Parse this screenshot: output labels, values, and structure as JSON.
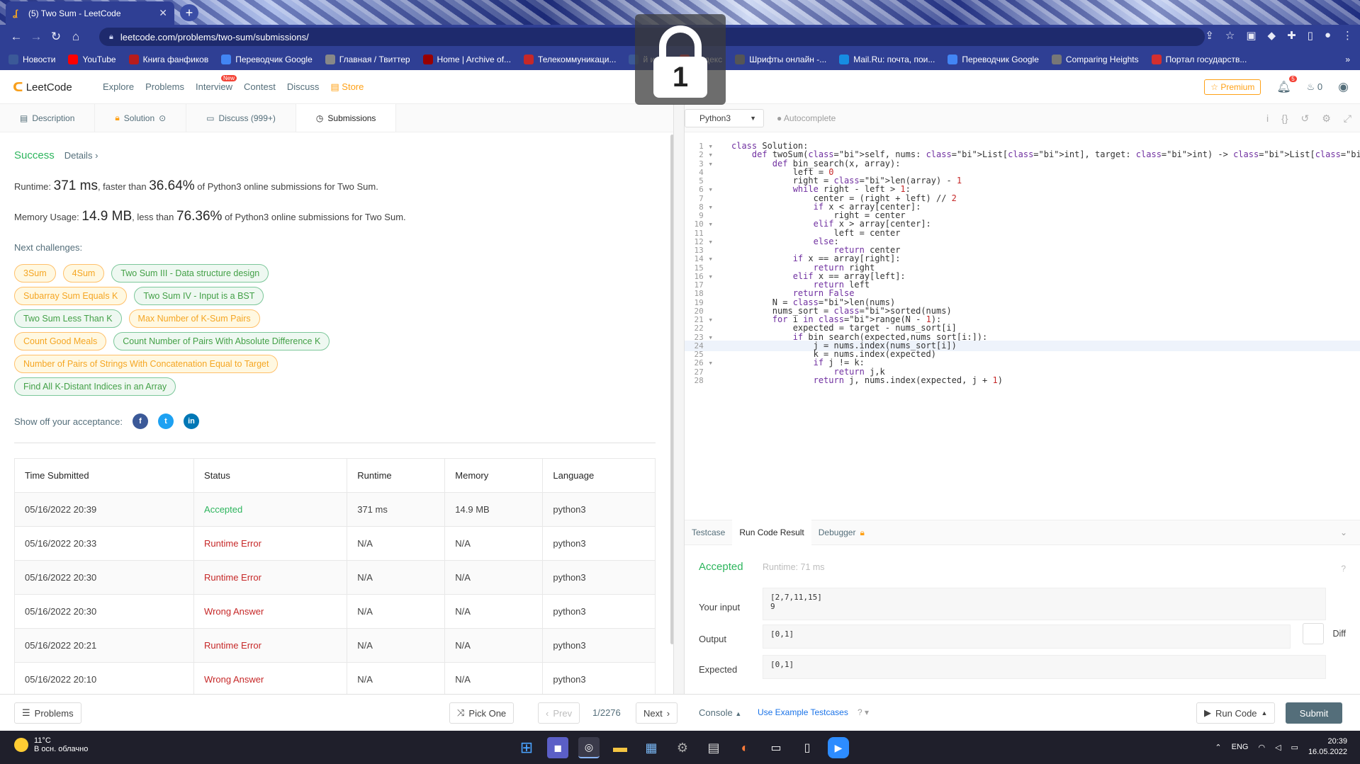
{
  "browser": {
    "tab_title": "(5) Two Sum - LeetCode",
    "url": "leetcode.com/problems/two-sum/submissions/",
    "bookmarks": [
      {
        "label": "Новости",
        "color": "#3b5998",
        "icon": "vk-icon"
      },
      {
        "label": "YouTube",
        "color": "#ff0000",
        "icon": "youtube-icon"
      },
      {
        "label": "Книга фанфиков",
        "color": "#b71c1c",
        "icon": "book-icon"
      },
      {
        "label": "Переводчик Google",
        "color": "#4285f4",
        "icon": "translate-icon"
      },
      {
        "label": "Главная / Твиттер",
        "color": "#888888",
        "icon": "globe-icon"
      },
      {
        "label": "Home | Archive of...",
        "color": "#990000",
        "icon": "ao3-icon"
      },
      {
        "label": "Телекоммуникаци...",
        "color": "#c62828",
        "icon": "globe-icon"
      },
      {
        "label": "й ин...",
        "color": "#3b5998",
        "icon": "globe-icon"
      },
      {
        "label": "Яндекс",
        "color": "#ff3333",
        "icon": "yandex-icon"
      },
      {
        "label": "Шрифты онлайн -...",
        "color": "#555555",
        "icon": "font-icon"
      },
      {
        "label": "Mail.Ru: почта, пои...",
        "color": "#168de2",
        "icon": "mail-icon"
      },
      {
        "label": "Переводчик Google",
        "color": "#4285f4",
        "icon": "translate-icon"
      },
      {
        "label": "Comparing Heights",
        "color": "#777777",
        "icon": "globe-icon"
      },
      {
        "label": "Портал государств...",
        "color": "#d32f2f",
        "icon": "gov-icon"
      }
    ],
    "more_bookmarks": "»"
  },
  "overlay": {
    "lock_number": "1"
  },
  "leetcode_nav": {
    "logo": "LeetCode",
    "links": [
      "Explore",
      "Problems",
      "Interview",
      "Contest",
      "Discuss"
    ],
    "new_badge": "New",
    "store": "Store",
    "premium": "Premium",
    "notifications": "5",
    "streak": "0"
  },
  "left_tabs": [
    {
      "label": "Description",
      "icon": "doc-icon"
    },
    {
      "label": "Solution",
      "icon": "lock-icon"
    },
    {
      "label": "Discuss (999+)",
      "icon": "chat-icon"
    },
    {
      "label": "Submissions",
      "icon": "clock-icon"
    }
  ],
  "submission": {
    "status": "Success",
    "details": "Details",
    "runtime_label": "Runtime: ",
    "runtime_value": "371 ms",
    "runtime_mid": ", faster than ",
    "runtime_pct": "36.64%",
    "runtime_tail": " of Python3 online submissions for Two Sum.",
    "memory_label": "Memory Usage: ",
    "memory_value": "14.9 MB",
    "memory_mid": ", less than ",
    "memory_pct": "76.36%",
    "memory_tail": " of Python3 online submissions for Two Sum.",
    "next_label": "Next challenges:",
    "show_off": "Show off your acceptance:"
  },
  "challenges": [
    [
      {
        "label": "3Sum",
        "level": "m"
      },
      {
        "label": "4Sum",
        "level": "m"
      },
      {
        "label": "Two Sum III - Data structure design",
        "level": "e"
      }
    ],
    [
      {
        "label": "Subarray Sum Equals K",
        "level": "m"
      },
      {
        "label": "Two Sum IV - Input is a BST",
        "level": "e"
      }
    ],
    [
      {
        "label": "Two Sum Less Than K",
        "level": "e"
      },
      {
        "label": "Max Number of K-Sum Pairs",
        "level": "m"
      }
    ],
    [
      {
        "label": "Count Good Meals",
        "level": "m"
      },
      {
        "label": "Count Number of Pairs With Absolute Difference K",
        "level": "e"
      }
    ],
    [
      {
        "label": "Number of Pairs of Strings With Concatenation Equal to Target",
        "level": "m"
      }
    ],
    [
      {
        "label": "Find All K-Distant Indices in an Array",
        "level": "e"
      }
    ]
  ],
  "table": {
    "headers": [
      "Time Submitted",
      "Status",
      "Runtime",
      "Memory",
      "Language"
    ],
    "rows": [
      [
        "05/16/2022 20:39",
        "Accepted",
        "371 ms",
        "14.9 MB",
        "python3"
      ],
      [
        "05/16/2022 20:33",
        "Runtime Error",
        "N/A",
        "N/A",
        "python3"
      ],
      [
        "05/16/2022 20:30",
        "Runtime Error",
        "N/A",
        "N/A",
        "python3"
      ],
      [
        "05/16/2022 20:30",
        "Wrong Answer",
        "N/A",
        "N/A",
        "python3"
      ],
      [
        "05/16/2022 20:21",
        "Runtime Error",
        "N/A",
        "N/A",
        "python3"
      ],
      [
        "05/16/2022 20:10",
        "Wrong Answer",
        "N/A",
        "N/A",
        "python3"
      ]
    ]
  },
  "editor": {
    "language": "Python3",
    "autocomplete": "Autocomplete",
    "highlighted_line": 24,
    "lines": [
      "class Solution:",
      "    def twoSum(self, nums: List[int], target: int) -> List[int]:",
      "        def bin_search(x, array):",
      "            left = 0",
      "            right = len(array) - 1",
      "            while right - left > 1:",
      "                center = (right + left) // 2",
      "                if x < array[center]:",
      "                    right = center",
      "                elif x > array[center]:",
      "                    left = center",
      "                else:",
      "                    return center",
      "            if x == array[right]:",
      "                return right",
      "            elif x == array[left]:",
      "                return left",
      "            return False",
      "        N = len(nums)",
      "        nums_sort = sorted(nums)",
      "        for i in range(N - 1):",
      "            expected = target - nums_sort[i]",
      "            if bin_search(expected,nums_sort[i:]):",
      "                j = nums.index(nums_sort[i])",
      "                k = nums.index(expected)",
      "                if j != k:",
      "                    return j,k",
      "                return j, nums.index(expected, j + 1)"
    ],
    "fold_lines": [
      1,
      2,
      3,
      6,
      8,
      10,
      12,
      14,
      16,
      21,
      23,
      26
    ]
  },
  "result_tabs": [
    "Testcase",
    "Run Code Result",
    "Debugger"
  ],
  "result": {
    "status": "Accepted",
    "runtime": "Runtime: 71 ms",
    "your_input_label": "Your input",
    "your_input": "[2,7,11,15]\n9",
    "output_label": "Output",
    "output": "[0,1]",
    "expected_label": "Expected",
    "expected": "[0,1]",
    "diff": "Diff"
  },
  "bottom_bar": {
    "problems": "Problems",
    "pick_one": "Pick One",
    "prev": "Prev",
    "page": "1/2276",
    "next": "Next",
    "console": "Console",
    "use_example": "Use Example Testcases",
    "run_code": "Run Code",
    "submit": "Submit"
  },
  "taskbar": {
    "temp": "11°C",
    "weather": "В осн. облачно",
    "lang": "ENG",
    "time": "20:39",
    "date": "16.05.2022"
  }
}
